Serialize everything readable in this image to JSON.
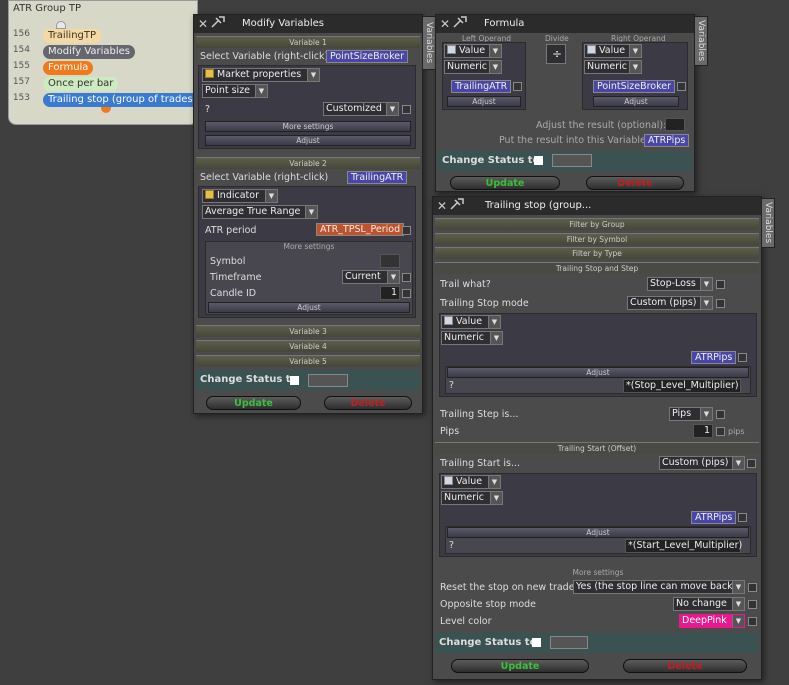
{
  "group": {
    "title": "ATR Group TP",
    "nodes": [
      {
        "id": "156",
        "label": "TrailingTP",
        "color": "#f6d9a0"
      },
      {
        "id": "154",
        "label": "Modify Variables",
        "color": "#66666e"
      },
      {
        "id": "155",
        "label": "Formula",
        "color": "#f07a1a"
      },
      {
        "id": "157",
        "label": "Once per bar",
        "color": "#cdeac0"
      },
      {
        "id": "153",
        "label": "Trailing stop (group of trades)",
        "color": "#3a7ad0"
      }
    ]
  },
  "modify": {
    "title": "Modify Variables",
    "tab": "Variables",
    "var1": {
      "header": "Variable 1",
      "select_label": "Select Variable (right-click)",
      "variable": "PointSizeBroker",
      "source": "Market properties",
      "property": "Point size",
      "param_label": "?",
      "param_value": "Customized",
      "more": "More settings",
      "adjust": "Adjust"
    },
    "var2": {
      "header": "Variable 2",
      "select_label": "Select Variable (right-click)",
      "variable": "TrailingATR",
      "source": "Indicator",
      "indicator": "Average True Range",
      "period_label": "ATR period",
      "period_value": "ATR_TPSL_Period",
      "more": "More settings",
      "symbol_label": "Symbol",
      "timeframe_label": "Timeframe",
      "timeframe_value": "Current",
      "candle_label": "Candle ID",
      "candle_value": "1",
      "adjust": "Adjust"
    },
    "var3": "Variable 3",
    "var4": "Variable 4",
    "var5": "Variable 5",
    "status_label": "Change Status to",
    "update": "Update",
    "delete": "Delete"
  },
  "formula": {
    "title": "Formula",
    "tab": "Variables",
    "left_label": "Left Operand",
    "divide_label": "Divide",
    "right_label": "Right Operand",
    "left_type": "Value",
    "left_kind": "Numeric",
    "left_value": "TrailingATR",
    "op_symbol": "÷",
    "right_type": "Value",
    "right_kind": "Numeric",
    "right_value": "PointSizeBroker",
    "adjust": "Adjust",
    "adjust_result_label": "Adjust the result (optional):",
    "result_label": "Put the result into this Variable:",
    "result_value": "ATRPips",
    "status_label": "Change Status to",
    "update": "Update",
    "delete": "Delete"
  },
  "trailing": {
    "title": "Trailing stop (group...",
    "tab": "Variables",
    "filter_group": "Filter by Group",
    "filter_symbol": "Filter by Symbol",
    "filter_type": "Filter by Type",
    "section_stop": "Trailing Stop and Step",
    "trail_what_label": "Trail what?",
    "trail_what_value": "Stop-Loss",
    "stop_mode_label": "Trailing Stop mode",
    "stop_mode_value": "Custom (pips)",
    "stop_type": "Value",
    "stop_kind": "Numeric",
    "stop_var": "ATRPips",
    "stop_adjust": "Adjust",
    "stop_q": "?",
    "stop_multiplier": "*(Stop_Level_Multiplier)",
    "step_label": "Trailing Step is...",
    "step_value": "Pips",
    "pips_label": "Pips",
    "pips_value": "1",
    "pips_unit": "pips",
    "section_start": "Trailing Start (Offset)",
    "start_label": "Trailing Start is...",
    "start_value": "Custom (pips)",
    "start_type": "Value",
    "start_kind": "Numeric",
    "start_var": "ATRPips",
    "start_adjust": "Adjust",
    "start_q": "?",
    "start_multiplier": "*(Start_Level_Multiplier)",
    "more": "More settings",
    "reset_label": "Reset the stop on new trade",
    "reset_value": "Yes (the stop line can move back)",
    "opposite_label": "Opposite stop mode",
    "opposite_value": "No change",
    "color_label": "Level color",
    "color_value": "DeepPink",
    "status_label": "Change Status to",
    "update": "Update",
    "delete": "Delete"
  },
  "colors": {
    "accent_blue": "#4946a8",
    "pink": "#e8198c",
    "green": "#3bc03b",
    "red": "#c02020"
  }
}
